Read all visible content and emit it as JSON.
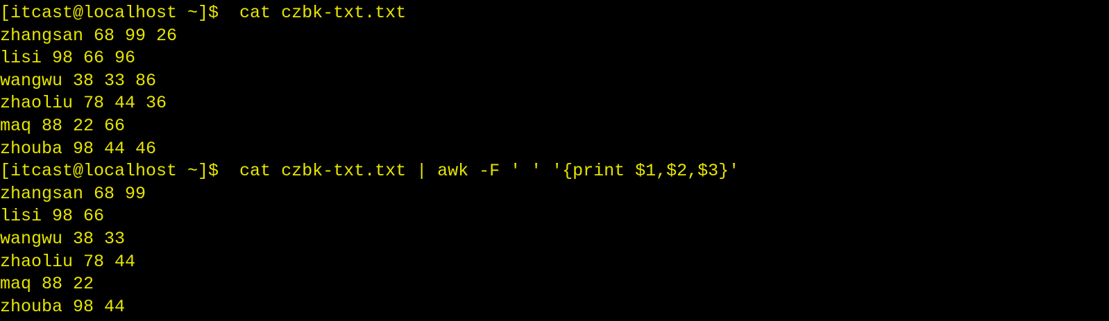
{
  "terminal": {
    "colors": {
      "background": "#000000",
      "text": "#e5e500"
    },
    "lines": [
      "[itcast@localhost ~]$  cat czbk-txt.txt",
      "zhangsan 68 99 26",
      "lisi 98 66 96",
      "wangwu 38 33 86",
      "zhaoliu 78 44 36",
      "maq 88 22 66",
      "zhouba 98 44 46",
      "[itcast@localhost ~]$  cat czbk-txt.txt | awk -F ' ' '{print $1,$2,$3}'",
      "zhangsan 68 99",
      "lisi 98 66",
      "wangwu 38 33",
      "zhaoliu 78 44",
      "maq 88 22",
      "zhouba 98 44"
    ]
  }
}
